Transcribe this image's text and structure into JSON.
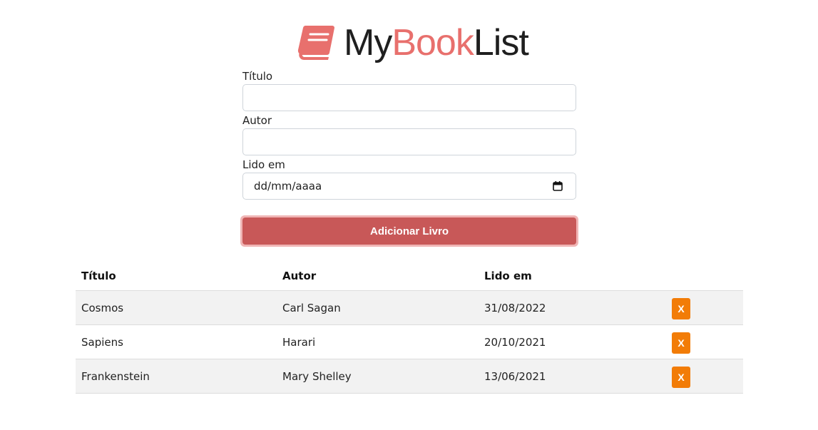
{
  "logo": {
    "part1": "My",
    "part2": "Book",
    "part3": "List",
    "icon": "book-icon",
    "accent_color": "#e8706d"
  },
  "form": {
    "title_label": "Título",
    "title_value": "",
    "author_label": "Autor",
    "author_value": "",
    "date_label": "Lido em",
    "date_placeholder": "dd/mm/aaaa",
    "submit_label": "Adicionar Livro",
    "submit_color": "#c85858"
  },
  "table": {
    "headers": {
      "title": "Título",
      "author": "Autor",
      "read_on": "Lido em"
    },
    "rows": [
      {
        "title": "Cosmos",
        "author": "Carl Sagan",
        "read_on": "31/08/2022",
        "delete_label": "X"
      },
      {
        "title": "Sapiens",
        "author": "Harari",
        "read_on": "20/10/2021",
        "delete_label": "X"
      },
      {
        "title": "Frankenstein",
        "author": "Mary Shelley",
        "read_on": "13/06/2021",
        "delete_label": "X"
      }
    ],
    "delete_color": "#f27c07"
  }
}
